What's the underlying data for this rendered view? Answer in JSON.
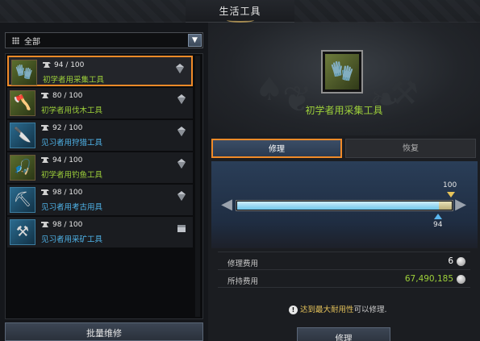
{
  "window": {
    "title": "生活工具"
  },
  "filter": {
    "selected": "全部"
  },
  "tools": [
    {
      "durability": "94 / 100",
      "name": "初学者用采集工具",
      "grade": "green",
      "icon": "gather-gloves-icon"
    },
    {
      "durability": "80 / 100",
      "name": "初学者用伐木工具",
      "grade": "green",
      "icon": "axe-icon"
    },
    {
      "durability": "92 / 100",
      "name": "见习者用狩猎工具",
      "grade": "blue",
      "icon": "hunting-knife-icon"
    },
    {
      "durability": "94 / 100",
      "name": "初学者用钓鱼工具",
      "grade": "green",
      "icon": "fishing-rod-icon"
    },
    {
      "durability": "98 / 100",
      "name": "见习者用考古用具",
      "grade": "blue",
      "icon": "shovel-icon"
    },
    {
      "durability": "98 / 100",
      "name": "见习者用采矿工具",
      "grade": "blue",
      "icon": "pickaxe-icon"
    }
  ],
  "bulk_repair_label": "批量维修",
  "detail": {
    "name": "初学者用采集工具",
    "tabs": {
      "repair": "修理",
      "restore": "恢复"
    },
    "durability": {
      "max": "100",
      "current": "94",
      "current_fraction": 0.94
    },
    "repair_cost_label": "修理费用",
    "repair_cost": "6",
    "owned_label": "所持费用",
    "owned": "67,490,185",
    "notice_highlight": "达到最大耐用性",
    "notice_rest": "可以修理.",
    "repair_button": "修理"
  },
  "colors": {
    "accent": "#f08a28",
    "green_grade": "#9ed13a",
    "blue_grade": "#4fb3e8"
  }
}
